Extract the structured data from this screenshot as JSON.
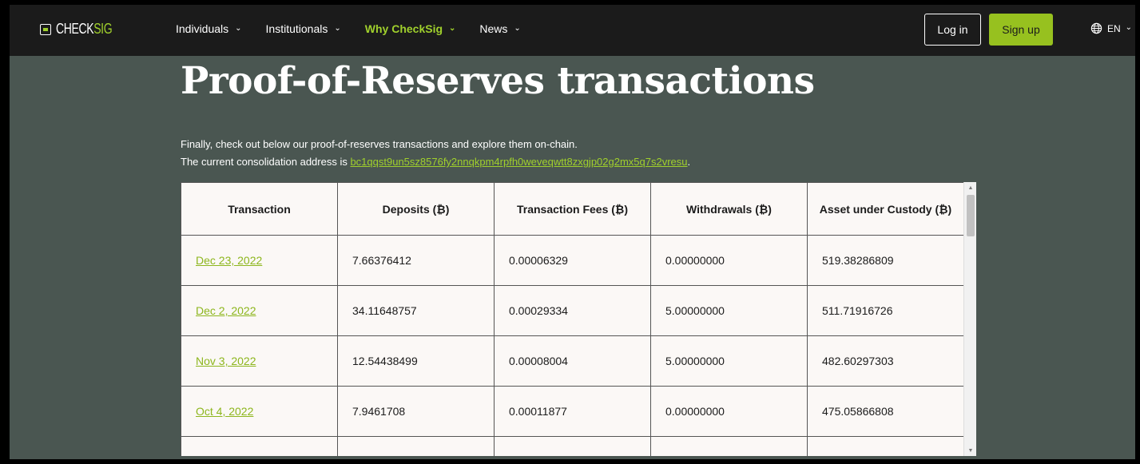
{
  "header": {
    "logo_text_main": "CHECK",
    "logo_text_accent": "SIG",
    "nav": [
      {
        "label": "Individuals",
        "active": false
      },
      {
        "label": "Institutionals",
        "active": false
      },
      {
        "label": "Why CheckSig",
        "active": true
      },
      {
        "label": "News",
        "active": false
      }
    ],
    "login_label": "Log in",
    "signup_label": "Sign up",
    "language": "EN"
  },
  "main": {
    "title": "Proof-of-Reserves transactions",
    "intro_line1": "Finally, check out below our proof-of-reserves transactions and explore them on-chain.",
    "intro_line2_prefix": "The current consolidation address is ",
    "address": "bc1qqst9un5sz8576fy2nnqkpm4rpfh0weveqwtt8zxgjp02g2mx5q7s2vresu",
    "intro_line2_suffix": "."
  },
  "table": {
    "headers": [
      "Transaction",
      "Deposits (₿)",
      "Transaction Fees (₿)",
      "Withdrawals (₿)",
      "Asset under Custody (₿)"
    ],
    "rows": [
      [
        "Dec 23, 2022",
        "7.66376412",
        "0.00006329",
        "0.00000000",
        "519.38286809"
      ],
      [
        "Dec 2, 2022",
        "34.11648757",
        "0.00029334",
        "5.00000000",
        "511.71916726"
      ],
      [
        "Nov 3, 2022",
        "12.54438499",
        "0.00008004",
        "5.00000000",
        "482.60297303"
      ],
      [
        "Oct 4, 2022",
        "7.9461708",
        "0.00011877",
        "0.00000000",
        "475.05866808"
      ]
    ]
  },
  "colors": {
    "accent": "#a0d02c",
    "header_bg": "#1b1b1b",
    "page_bg": "#4a5651",
    "table_bg": "#fbf8f6"
  }
}
